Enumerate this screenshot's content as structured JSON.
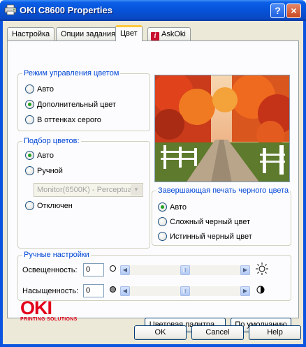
{
  "window": {
    "title": "OKI C8600 Properties",
    "help_button": "?",
    "close_button": "×"
  },
  "tabs": [
    {
      "label": "Настройка",
      "active": false
    },
    {
      "label": "Опции задания",
      "active": false
    },
    {
      "label": "Цвет",
      "active": true
    },
    {
      "label": "AskOki",
      "active": false
    }
  ],
  "color_mode": {
    "title": "Режим управления цветом",
    "options": [
      {
        "label": "Авто",
        "checked": false
      },
      {
        "label": "Дополнительный цвет",
        "checked": true
      },
      {
        "label": "В оттенках серого",
        "checked": false
      }
    ]
  },
  "color_matching": {
    "title": "Подбор цветов:",
    "options": [
      {
        "label": "Авто",
        "checked": true
      },
      {
        "label": "Ручной",
        "checked": false
      },
      {
        "label": "Отключен",
        "checked": false
      }
    ],
    "profile_select": "Monitor(6500K) - Perceptual"
  },
  "black_finish": {
    "title": "Завершающая печать черного цвета",
    "options": [
      {
        "label": "Авто",
        "checked": true
      },
      {
        "label": "Сложный черный цвет",
        "checked": false
      },
      {
        "label": "Истинный черный цвет",
        "checked": false
      }
    ]
  },
  "manual": {
    "title": "Ручные настройки",
    "brightness_label": "Освещенность:",
    "brightness_value": "0",
    "saturation_label": "Насыщенность:",
    "saturation_value": "0",
    "brightness_level": 0.5,
    "saturation_level": 0.5
  },
  "buttons": {
    "palette": "Цветовая палитра...",
    "defaults": "По умолчанию",
    "ok": "OK",
    "cancel": "Cancel",
    "help": "Help"
  },
  "logo": {
    "main": "OKI",
    "sub": "PRINTING SOLUTIONS"
  },
  "colors": {
    "title_bar": "#0552d8",
    "accent": "#0046d5",
    "logo_red": "#e2001a",
    "dialog_bg": "#ece9d8"
  }
}
